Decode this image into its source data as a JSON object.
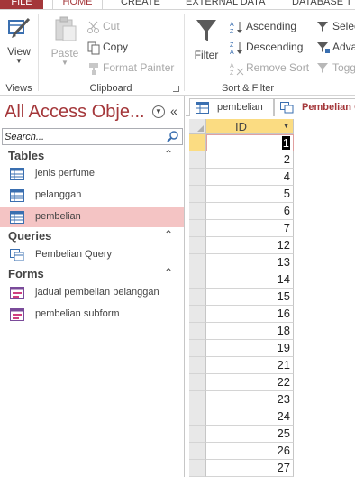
{
  "ribbon_tabs": [
    "FILE",
    "HOME",
    "CREATE",
    "EXTERNAL DATA",
    "DATABASE T"
  ],
  "groups": {
    "views": {
      "label": "Views",
      "view_button": "View"
    },
    "clipboard": {
      "label": "Clipboard",
      "paste": "Paste",
      "cut": "Cut",
      "copy": "Copy",
      "format_painter": "Format Painter"
    },
    "sort_filter": {
      "label": "Sort & Filter",
      "filter": "Filter",
      "ascending": "Ascending",
      "descending": "Descending",
      "remove_sort": "Remove Sort",
      "selection_partial": "Selec",
      "advanced_partial": "Adva",
      "toggle_partial": "Togg"
    }
  },
  "nav": {
    "title": "All Access Obje...",
    "search_placeholder": "Search...",
    "sections": [
      {
        "title": "Tables",
        "items": [
          "jenis perfume",
          "pelanggan",
          "pembelian"
        ]
      },
      {
        "title": "Queries",
        "items": [
          "Pembelian Query"
        ]
      },
      {
        "title": "Forms",
        "items": [
          "jadual pembelian pelanggan",
          "pembelian subform"
        ]
      }
    ],
    "selected_item": "pembelian"
  },
  "doc_tabs": [
    "pembelian",
    "Pembelian Q"
  ],
  "active_doc_tab": "Pembelian Q",
  "grid": {
    "column_header": "ID",
    "rows": [
      "1",
      "2",
      "4",
      "5",
      "6",
      "7",
      "12",
      "13",
      "14",
      "15",
      "16",
      "18",
      "19",
      "21",
      "22",
      "23",
      "24",
      "25",
      "26",
      "27"
    ],
    "current_row": 0
  },
  "colors": {
    "accent": "#a4373a",
    "selected_nav": "#f4c4c4",
    "header_highlight": "#fbdc82"
  }
}
